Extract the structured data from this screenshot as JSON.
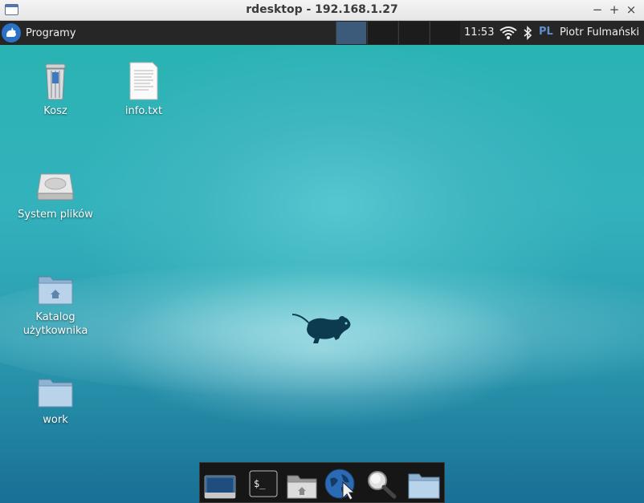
{
  "window": {
    "title": "rdesktop - 192.168.1.27",
    "buttons": [
      "−",
      "+",
      "×"
    ]
  },
  "panel": {
    "menu_label": "Programy",
    "workspaces": 4,
    "active_workspace": 1,
    "clock": "11:53",
    "keyboard_layout": "PL",
    "user": "Piotr Fulmański",
    "tray_icons": [
      "wifi-icon",
      "bluetooth-icon"
    ]
  },
  "desktop": {
    "icons": [
      {
        "label": "Kosz",
        "icon": "trash-icon"
      },
      {
        "label": "info.txt",
        "icon": "text-file-icon"
      },
      {
        "label": "System plików",
        "icon": "hard-drive-icon"
      },
      {
        "label": "Katalog użytkownika",
        "icon": "home-folder-icon"
      },
      {
        "label": "work",
        "icon": "folder-icon"
      }
    ]
  },
  "dock": {
    "items": [
      "show-desktop-icon",
      "terminal-icon",
      "file-manager-icon",
      "web-browser-icon",
      "search-icon",
      "folder-icon"
    ]
  },
  "colors": {
    "panel": "#262626",
    "accent": "#2a72c6",
    "desktop_top": "#2ab3b3",
    "desktop_bottom": "#196f95"
  }
}
